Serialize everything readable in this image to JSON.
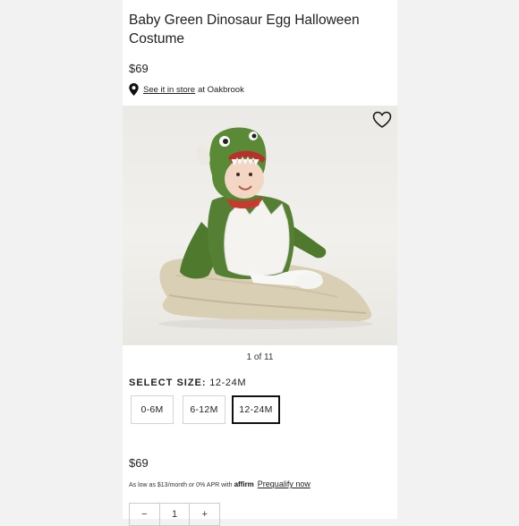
{
  "product": {
    "title": "Baby Green Dinosaur Egg Halloween Costume",
    "price": "$69"
  },
  "store": {
    "link_text": "See it in store",
    "location_text": "at Oakbrook",
    "icon": "map-pin-icon"
  },
  "gallery": {
    "counter": "1 of 11",
    "favorite_icon": "heart-icon"
  },
  "size": {
    "label": "SELECT SIZE:",
    "selected": "12-24M",
    "options": [
      "0-6M",
      "6-12M",
      "12-24M"
    ]
  },
  "purchase": {
    "price": "$69",
    "financing_prefix": "As low as $13/month or 0% APR with",
    "affirm_logo": "affirm",
    "prequalify": "Prequalify now"
  },
  "quantity": {
    "minus": "−",
    "value": "1",
    "plus": "+"
  },
  "colors": {
    "page_bg": "#f2f2f2",
    "card_bg": "#ffffff",
    "selected_border": "#111111",
    "costume_green": "#4f7a2e"
  }
}
